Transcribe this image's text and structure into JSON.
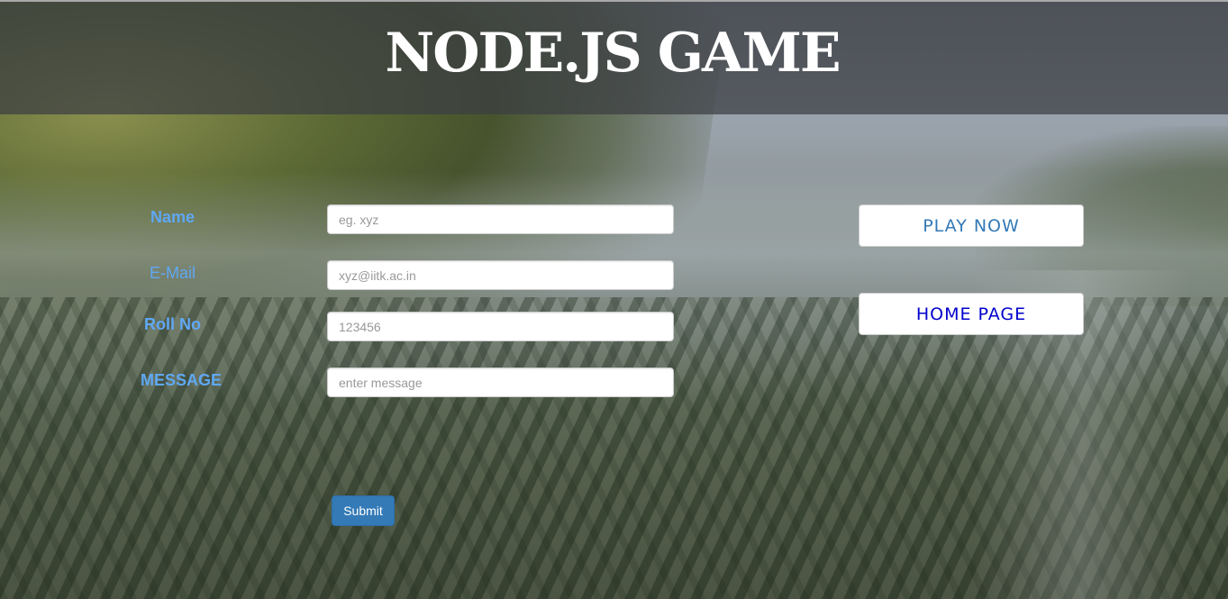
{
  "header": {
    "title": "NODE.JS GAME"
  },
  "form": {
    "fields": [
      {
        "label": "Name",
        "placeholder": "eg. xyz"
      },
      {
        "label": "E-Mail",
        "placeholder": "xyz@iitk.ac.in"
      },
      {
        "label": "Roll No",
        "placeholder": "123456"
      },
      {
        "label": "MESSAGE",
        "placeholder": "enter message"
      }
    ],
    "submit_label": "Submit"
  },
  "nav": {
    "play_label": "PLAY NOW",
    "home_label": "HOME PAGE"
  },
  "colors": {
    "label": "#5fa8f4",
    "submit_bg": "#337ab7",
    "play_text": "#337ab7",
    "home_text": "#0000cc"
  }
}
